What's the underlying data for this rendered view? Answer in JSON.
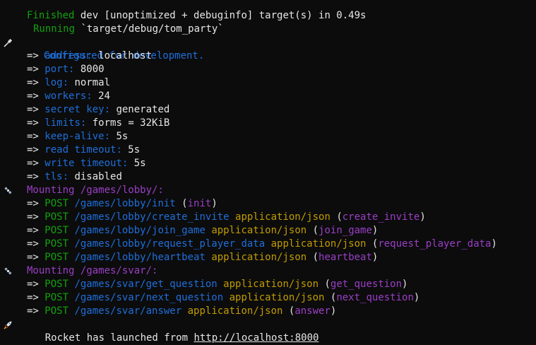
{
  "colors": {
    "background": "#0c0c0c",
    "green": "#13a10e",
    "blue": "#1f6fdb",
    "purple": "#9a3fc7",
    "yellow": "#c19c00",
    "white": "#e6e6e6"
  },
  "cargo": {
    "finished_word": "Finished",
    "finished_rest": " dev [unoptimized + debuginfo] target(s) in 0.49s",
    "running_word": "Running",
    "running_rest": " `target/debug/tom_party`"
  },
  "config": {
    "icon": "wrench-icon",
    "heading": "Configured for development.",
    "arrow": "=> ",
    "items": [
      {
        "key": "address:",
        "value": " localhost"
      },
      {
        "key": "port:",
        "value": " 8000"
      },
      {
        "key": "log:",
        "value": " normal"
      },
      {
        "key": "workers:",
        "value": " 24"
      },
      {
        "key": "secret key:",
        "value": " generated"
      },
      {
        "key": "limits:",
        "value": " forms = 32KiB"
      },
      {
        "key": "keep-alive:",
        "value": " 5s"
      },
      {
        "key": "read timeout:",
        "value": " 5s"
      },
      {
        "key": "write timeout:",
        "value": " 5s"
      },
      {
        "key": "tls:",
        "value": " disabled"
      }
    ]
  },
  "mounts": [
    {
      "icon": "satellite-icon",
      "heading": "Mounting /games/lobby/:",
      "routes": [
        {
          "method": "POST",
          "path": " /games/lobby/init",
          "format": "",
          "handler": "init"
        },
        {
          "method": "POST",
          "path": " /games/lobby/create_invite",
          "format": " application/json",
          "handler": "create_invite"
        },
        {
          "method": "POST",
          "path": " /games/lobby/join_game",
          "format": " application/json",
          "handler": "join_game"
        },
        {
          "method": "POST",
          "path": " /games/lobby/request_player_data",
          "format": " application/json",
          "handler": "request_player_data"
        },
        {
          "method": "POST",
          "path": " /games/lobby/heartbeat",
          "format": " application/json",
          "handler": "heartbeat"
        }
      ]
    },
    {
      "icon": "satellite-icon",
      "heading": "Mounting /games/svar/:",
      "routes": [
        {
          "method": "POST",
          "path": " /games/svar/get_question",
          "format": " application/json",
          "handler": "get_question"
        },
        {
          "method": "POST",
          "path": " /games/svar/next_question",
          "format": " application/json",
          "handler": "next_question"
        },
        {
          "method": "POST",
          "path": " /games/svar/answer",
          "format": " application/json",
          "handler": "answer"
        }
      ]
    }
  ],
  "launch": {
    "icon": "rocket-icon",
    "text": "Rocket has launched from ",
    "url": "http://localhost:8000"
  }
}
